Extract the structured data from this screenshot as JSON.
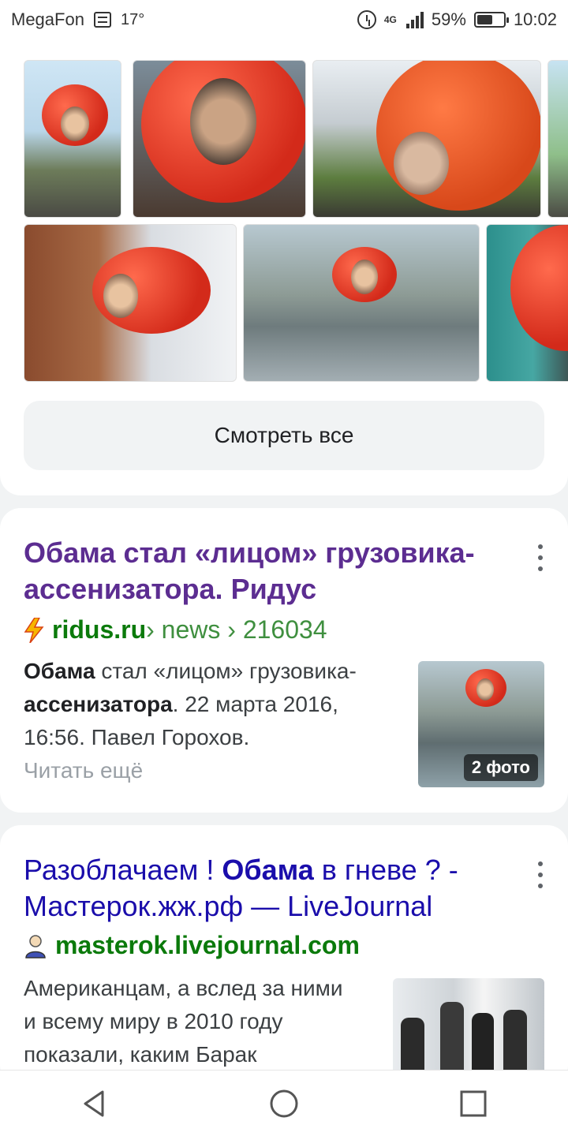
{
  "status_bar": {
    "carrier": "MegaFon",
    "temperature": "17°",
    "network": "4G",
    "battery_percent": "59%",
    "battery_level": 0.59,
    "time": "10:02"
  },
  "image_block": {
    "see_all_label": "Смотреть все"
  },
  "results": [
    {
      "title": "Обама стал «лицом» грузовика-ассенизатора. Ридус",
      "title_color": "#5c2d91",
      "domain": "ridus.ru",
      "path": " › news › 216034",
      "favicon": "lightning-icon",
      "snippet_bold_1": "Обама",
      "snippet_text_1": " стал «лицом» грузовика-",
      "snippet_bold_2": "ассенизатора",
      "snippet_text_2": ". 22 марта 2016, 16:56. Павел Горохов.",
      "read_more": "Читать ещё",
      "photo_badge": "2 фото"
    },
    {
      "title_part_1": "Разоблачаем ! ",
      "title_part_2": "Обама",
      "title_part_3": " в гневе ? - Мастерок.жж.рф — LiveJournal",
      "title_color": "#1a0dab",
      "domain": "masterok.livejournal.com",
      "favicon": "user-avatar-icon",
      "snippet": "Американцам, а вслед за ними и всему миру в 2010 году показали, каким Барак"
    }
  ],
  "nav": {
    "back": "back-icon",
    "home": "home-icon",
    "recents": "recents-icon"
  }
}
